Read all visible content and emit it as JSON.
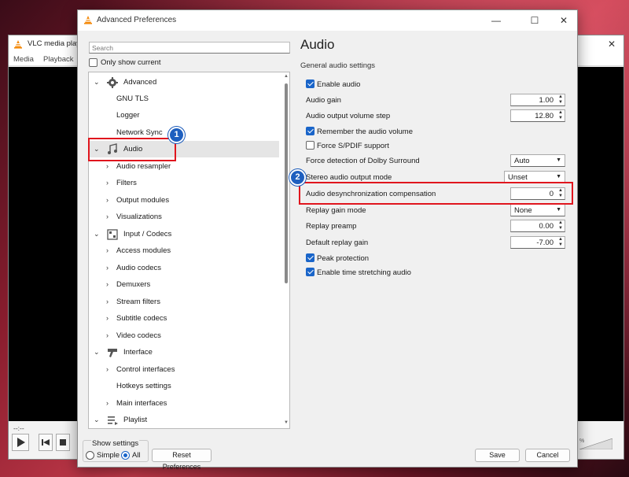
{
  "background_window": {
    "title": "VLC media playe",
    "menu": [
      "Media",
      "Playback"
    ],
    "time_left": "--:--",
    "volume_pct": "%"
  },
  "dialog": {
    "title": "Advanced Preferences",
    "search_placeholder": "Search",
    "only_show_current": "Only show current",
    "tree": [
      {
        "label": "Advanced",
        "level": 0,
        "expanded": true,
        "icon": "gear-icon"
      },
      {
        "label": "GNU TLS",
        "level": 1
      },
      {
        "label": "Logger",
        "level": 1
      },
      {
        "label": "Network Sync",
        "level": 1
      },
      {
        "label": "Audio",
        "level": 0,
        "expanded": true,
        "icon": "audio-note-icon",
        "selected": true
      },
      {
        "label": "Audio resampler",
        "level": 1,
        "has_children": true
      },
      {
        "label": "Filters",
        "level": 1,
        "has_children": true
      },
      {
        "label": "Output modules",
        "level": 1,
        "has_children": true
      },
      {
        "label": "Visualizations",
        "level": 1,
        "has_children": true
      },
      {
        "label": "Input / Codecs",
        "level": 0,
        "expanded": true,
        "icon": "codec-icon"
      },
      {
        "label": "Access modules",
        "level": 1,
        "has_children": true
      },
      {
        "label": "Audio codecs",
        "level": 1,
        "has_children": true
      },
      {
        "label": "Demuxers",
        "level": 1,
        "has_children": true
      },
      {
        "label": "Stream filters",
        "level": 1,
        "has_children": true
      },
      {
        "label": "Subtitle codecs",
        "level": 1,
        "has_children": true
      },
      {
        "label": "Video codecs",
        "level": 1,
        "has_children": true
      },
      {
        "label": "Interface",
        "level": 0,
        "expanded": true,
        "icon": "interface-icon"
      },
      {
        "label": "Control interfaces",
        "level": 1,
        "has_children": true
      },
      {
        "label": "Hotkeys settings",
        "level": 1
      },
      {
        "label": "Main interfaces",
        "level": 1,
        "has_children": true
      },
      {
        "label": "Playlist",
        "level": 0,
        "expanded": true,
        "icon": "playlist-icon"
      }
    ],
    "panel_title": "Audio",
    "group_title": "General audio settings",
    "settings": {
      "enable_audio": {
        "label": "Enable audio",
        "checked": true
      },
      "audio_gain": {
        "label": "Audio gain",
        "value": "1.00"
      },
      "volume_step": {
        "label": "Audio output volume step",
        "value": "12.80"
      },
      "remember_volume": {
        "label": "Remember the audio volume",
        "checked": true
      },
      "force_spdif": {
        "label": "Force S/PDIF support",
        "checked": false
      },
      "dolby": {
        "label": "Force detection of Dolby Surround",
        "value": "Auto"
      },
      "stereo_mode": {
        "label": "Stereo audio output mode",
        "value": "Unset"
      },
      "desync": {
        "label": "Audio desynchronization compensation",
        "value": "0"
      },
      "replay_gain_mode": {
        "label": "Replay gain mode",
        "value": "None"
      },
      "replay_preamp": {
        "label": "Replay preamp",
        "value": "0.00"
      },
      "default_replay_gain": {
        "label": "Default replay gain",
        "value": "-7.00"
      },
      "peak_protection": {
        "label": "Peak protection",
        "checked": true
      },
      "time_stretch": {
        "label": "Enable time stretching audio",
        "checked": true
      }
    },
    "show_settings": {
      "caption": "Show settings",
      "simple": "Simple",
      "all": "All",
      "selected": "All"
    },
    "buttons": {
      "reset": "Reset Preferences",
      "save": "Save",
      "cancel": "Cancel"
    },
    "callouts": [
      "1",
      "2"
    ]
  },
  "colors": {
    "highlight": "#e0161e",
    "accent": "#1a65c9",
    "badge": "#1e5fbf"
  }
}
